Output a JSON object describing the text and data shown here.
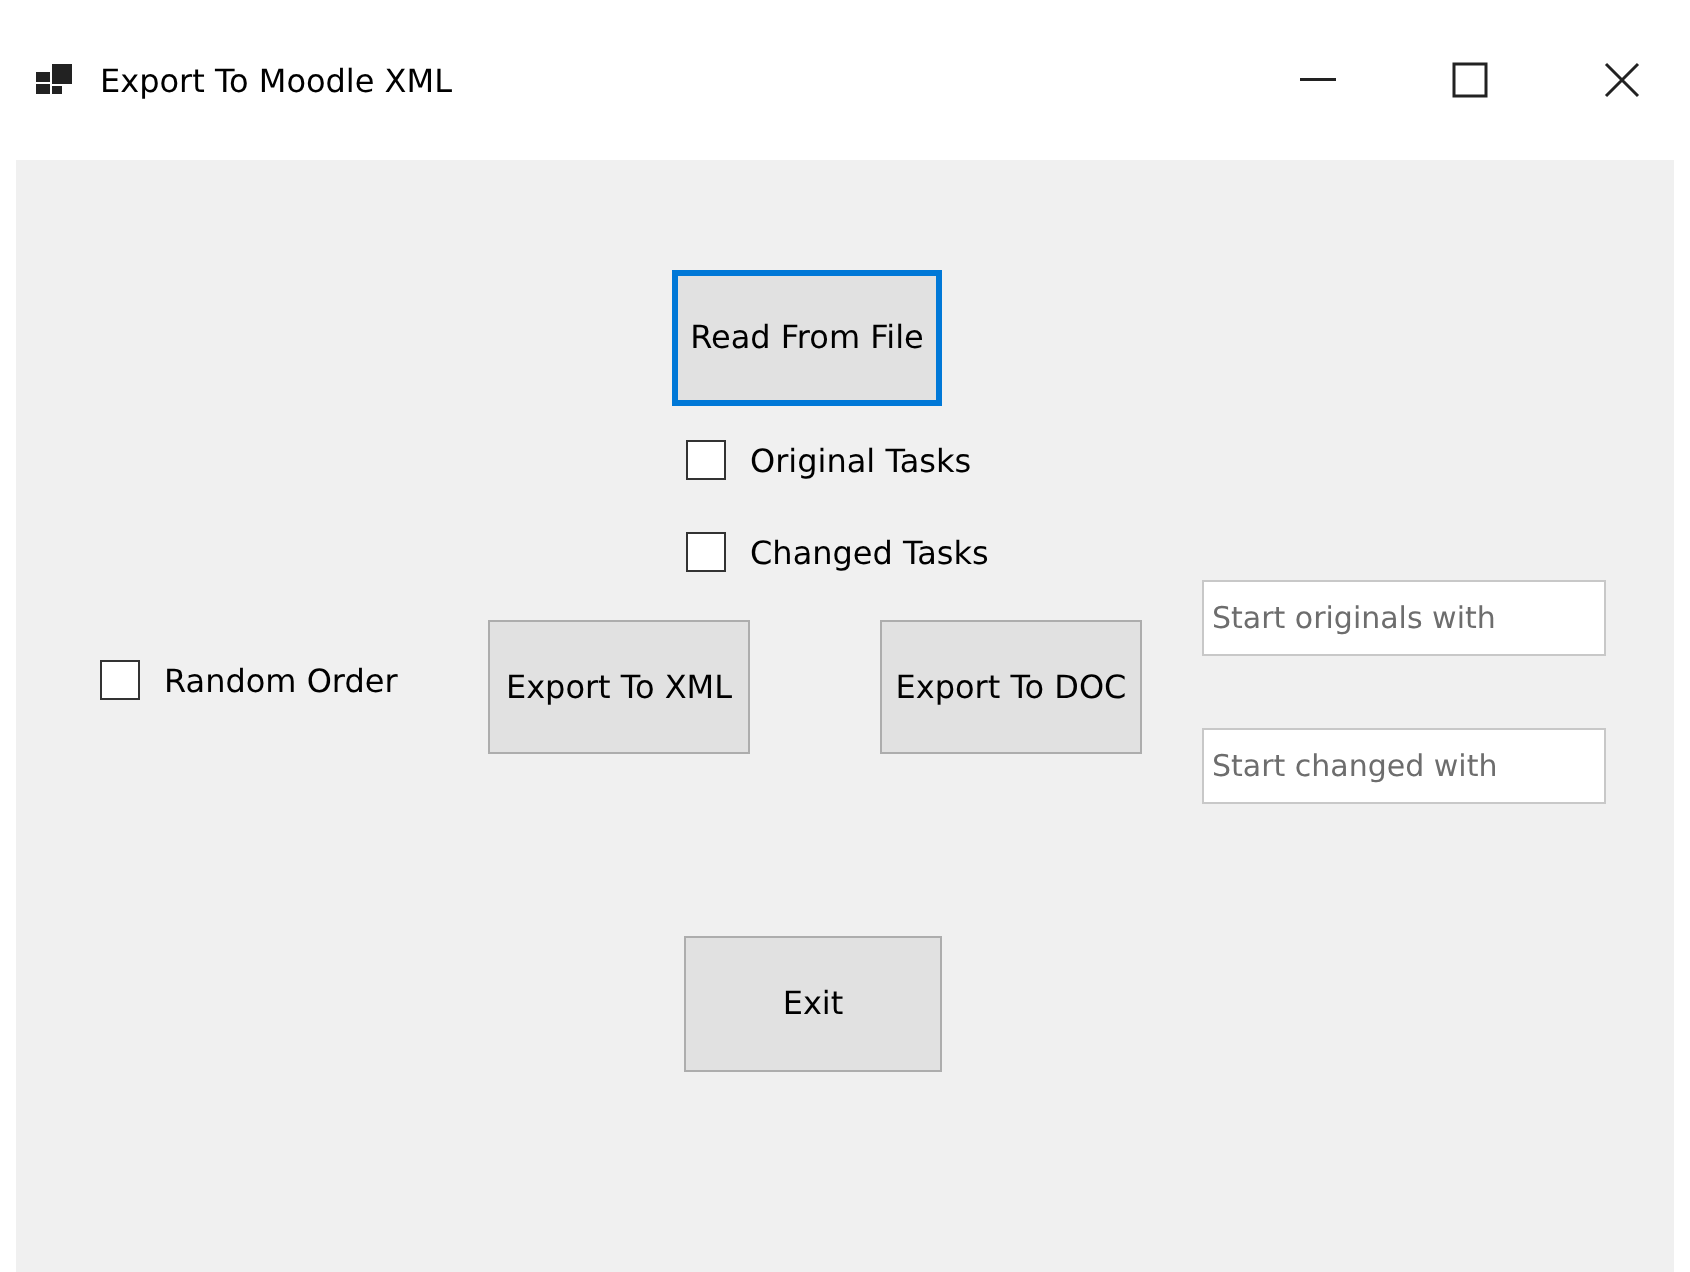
{
  "window": {
    "title": "Export To Moodle XML"
  },
  "read_button": {
    "label": "Read From File",
    "focused": true
  },
  "task_options": [
    {
      "label": "Original Tasks",
      "checked": false
    },
    {
      "label": "Changed Tasks",
      "checked": false
    }
  ],
  "random_order": {
    "label": "Random Order",
    "checked": false
  },
  "export_buttons": [
    {
      "label": "Export To XML",
      "focused": false
    },
    {
      "label": "Export To DOC",
      "focused": false
    }
  ],
  "prefix_fields": [
    {
      "placeholder": "Start originals with"
    },
    {
      "placeholder": "Start changed with"
    }
  ],
  "exit_button": {
    "label": "Exit",
    "focused": false
  }
}
